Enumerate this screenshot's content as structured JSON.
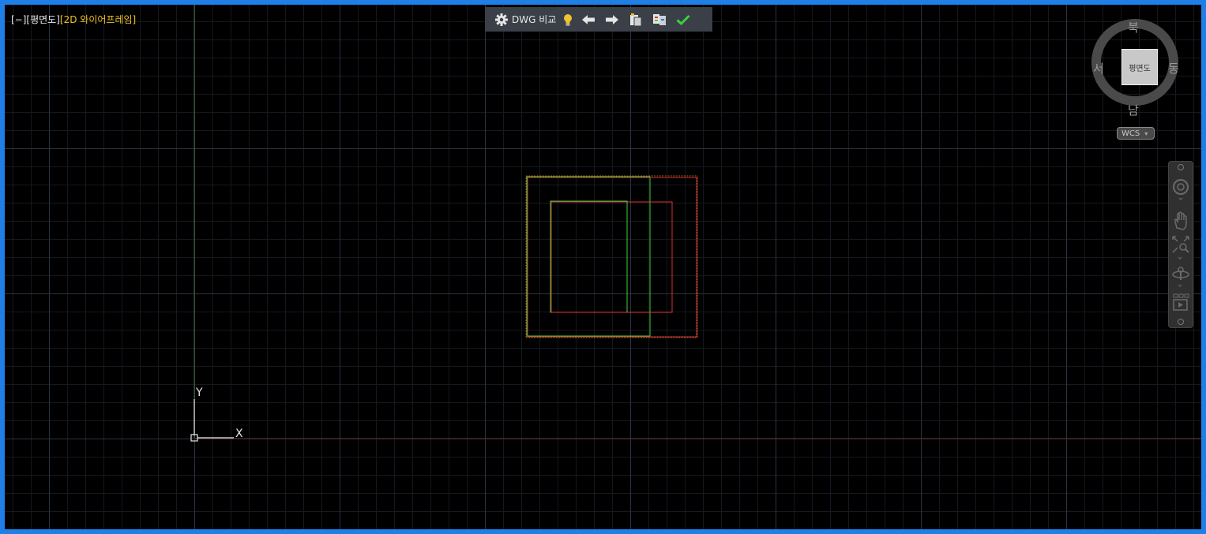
{
  "viewport": {
    "control": "[−]",
    "view": "[평면도]",
    "style": "[2D 와이어프레임]"
  },
  "toolbar": {
    "label": "DWG 비교",
    "items": [
      "settings-icon",
      "lightbulb-icon",
      "arrow-left-icon",
      "arrow-right-icon",
      "export-snapshot-icon",
      "compare-swap-icon",
      "checkmark-icon"
    ]
  },
  "viewcube": {
    "north": "북",
    "south": "남",
    "east": "동",
    "west": "서",
    "face": "평면도",
    "wcs": "WCS"
  },
  "ucs": {
    "x": "X",
    "y": "Y"
  },
  "colors": {
    "background": "#000000",
    "frame": "#1e7fe6",
    "grid_major": "#2b3242",
    "grid_minor": "#141820",
    "green_geometry": "#3fcf3f",
    "red_geometry": "#e03030",
    "y_axis": "#3a6a3a",
    "x_axis": "#5a2a2a"
  }
}
